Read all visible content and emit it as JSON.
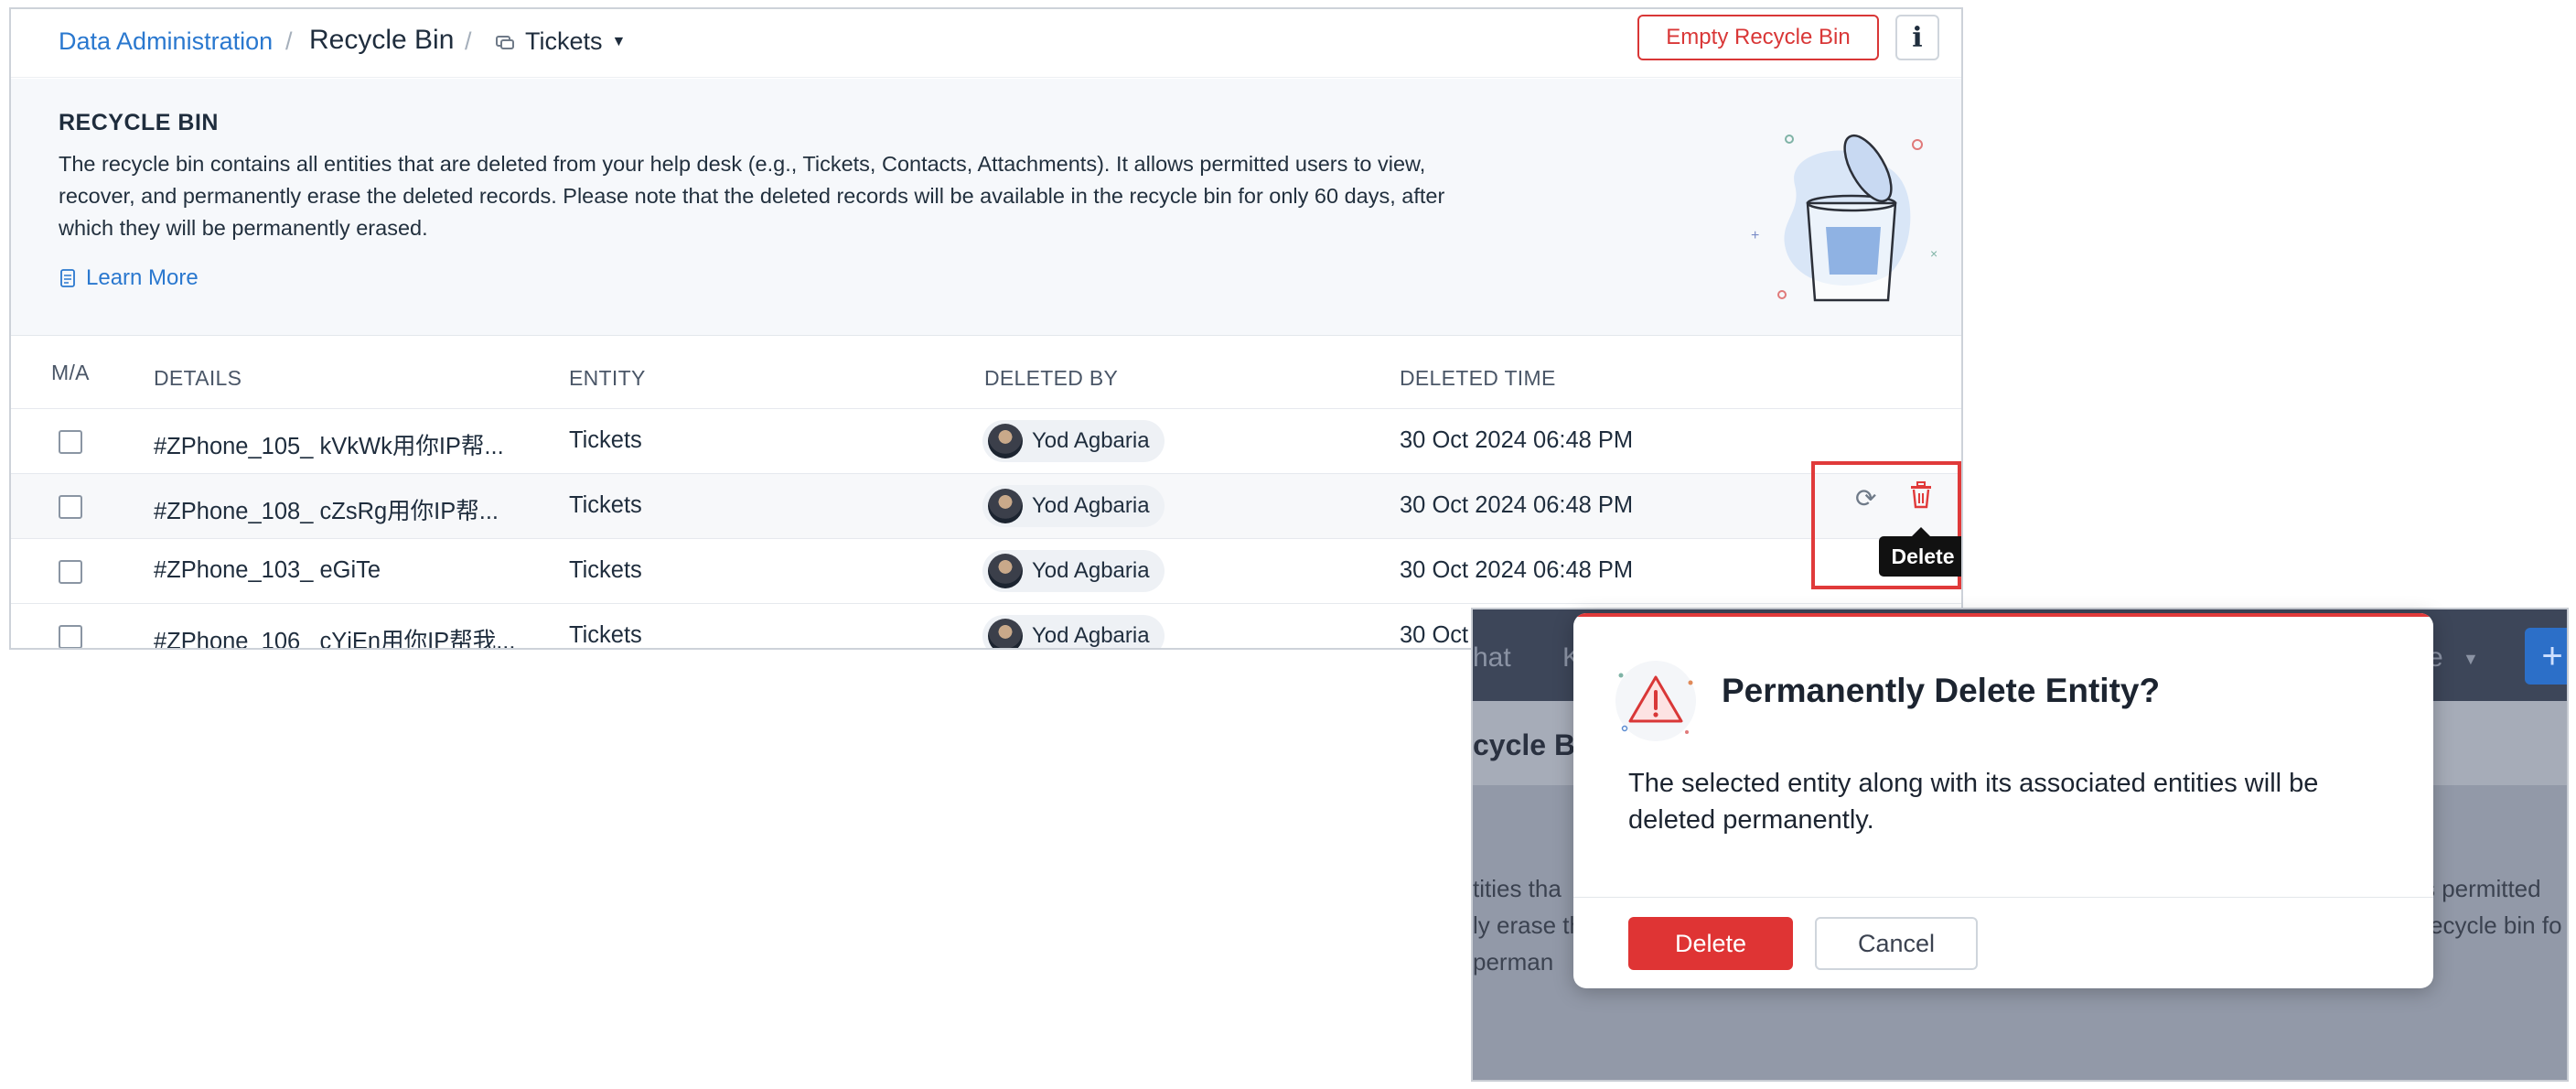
{
  "breadcrumb": {
    "link": "Data Administration",
    "separator": "/",
    "current": "Recycle Bin",
    "module": "Tickets"
  },
  "header_actions": {
    "empty_label": "Empty Recycle Bin",
    "info_label": "i"
  },
  "banner": {
    "title": "RECYCLE BIN",
    "description": "The recycle bin contains all entities that are deleted from your help desk (e.g., Tickets, Contacts, Attachments). It allows permitted users to view, recover, and permanently erase the deleted records. Please note that the deleted records will be available in the recycle bin for only 60 days, after which they will be permanently erased.",
    "learn_more": "Learn More"
  },
  "table": {
    "columns": [
      "M/A",
      "DETAILS",
      "ENTITY",
      "DELETED BY",
      "DELETED TIME"
    ],
    "rows": [
      {
        "details": "#ZPhone_105_ kVkWk用你IP帮...",
        "entity": "Tickets",
        "deleted_by": "Yod Agbaria",
        "time": "30 Oct 2024 06:48 PM"
      },
      {
        "details": "#ZPhone_108_ cZsRg用你IP帮...",
        "entity": "Tickets",
        "deleted_by": "Yod Agbaria",
        "time": "30 Oct 2024 06:48 PM"
      },
      {
        "details": "#ZPhone_103_ eGiTe",
        "entity": "Tickets",
        "deleted_by": "Yod Agbaria",
        "time": "30 Oct 2024 06:48 PM"
      },
      {
        "details": "#ZPhone_106_ cYjEn用你IP帮我...",
        "entity": "Tickets",
        "deleted_by": "Yod Agbaria",
        "time": "30 Oct"
      }
    ],
    "row_actions": {
      "restore_icon": "refresh-icon",
      "delete_icon": "trash-icon",
      "tooltip": "Delete"
    }
  },
  "background_page": {
    "nav_items": [
      "hat",
      "K",
      "e"
    ],
    "title": "cycle Bi",
    "fragments": [
      "tities tha",
      "ly erase th",
      "perman",
      "ys permitted",
      "ecycle bin fo"
    ]
  },
  "modal": {
    "title": "Permanently Delete Entity?",
    "body": "The selected entity along with its associated entities will be deleted permanently.",
    "delete_label": "Delete",
    "cancel_label": "Cancel",
    "icon": "warning-triangle-icon"
  },
  "colors": {
    "accent": "#2a78cf",
    "danger": "#df3434",
    "highlight": "#e03a3a"
  }
}
